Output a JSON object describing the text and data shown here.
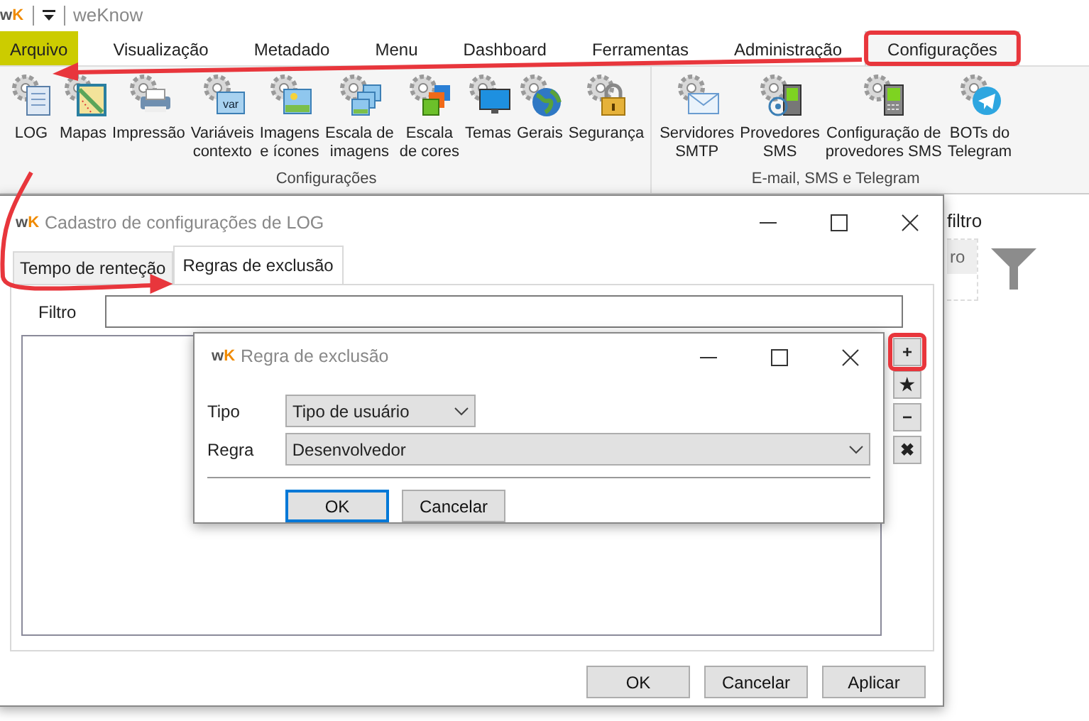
{
  "app": {
    "logo": {
      "left": "w",
      "right": "K"
    },
    "title": "weKnow"
  },
  "menu_tabs": [
    {
      "label": "Arquivo",
      "kind": "file",
      "selected": false,
      "highlighted": false
    },
    {
      "label": "Visualização",
      "kind": "tab",
      "selected": false,
      "highlighted": false
    },
    {
      "label": "Metadado",
      "kind": "tab",
      "selected": false,
      "highlighted": false
    },
    {
      "label": "Menu",
      "kind": "tab",
      "selected": false,
      "highlighted": false
    },
    {
      "label": "Dashboard",
      "kind": "tab",
      "selected": false,
      "highlighted": false
    },
    {
      "label": "Ferramentas",
      "kind": "tab",
      "selected": false,
      "highlighted": false
    },
    {
      "label": "Administração",
      "kind": "tab",
      "selected": false,
      "highlighted": false
    },
    {
      "label": "Configurações",
      "kind": "tab",
      "selected": true,
      "highlighted": true
    }
  ],
  "ribbon_groups": [
    {
      "label": "Configurações",
      "buttons": [
        {
          "lines": [
            "LOG"
          ],
          "kind": "notebook",
          "arrow_to_tab": true
        },
        {
          "lines": [
            "Mapas"
          ],
          "kind": "map"
        },
        {
          "lines": [
            "Impressão"
          ],
          "kind": "printer"
        },
        {
          "lines": [
            "Variáveis",
            "contexto"
          ],
          "kind": "var",
          "icon_text": "var"
        },
        {
          "lines": [
            "Imagens",
            "e ícones"
          ],
          "kind": "image"
        },
        {
          "lines": [
            "Escala de",
            "imagens"
          ],
          "kind": "images"
        },
        {
          "lines": [
            "Escala",
            "de cores"
          ],
          "kind": "colors"
        },
        {
          "lines": [
            "Temas"
          ],
          "kind": "monitor"
        },
        {
          "lines": [
            "Gerais"
          ],
          "kind": "globe"
        },
        {
          "lines": [
            "Segurança"
          ],
          "kind": "lock"
        }
      ]
    },
    {
      "label": "E-mail, SMS e Telegram",
      "buttons": [
        {
          "lines": [
            "Servidores",
            "SMTP"
          ],
          "kind": "mail"
        },
        {
          "lines": [
            "Provedores",
            "SMS"
          ],
          "kind": "antenna"
        },
        {
          "lines": [
            "Configuração de",
            "provedores SMS"
          ],
          "kind": "phone"
        },
        {
          "lines": [
            "BOTs do",
            "Telegram"
          ],
          "kind": "telegram"
        }
      ]
    }
  ],
  "background_panel": {
    "heading": "filtro",
    "field_text": "ro"
  },
  "main_dialog": {
    "logo": {
      "left": "w",
      "right": "K"
    },
    "title": "Cadastro de configurações de LOG",
    "tabs": [
      {
        "label": "Tempo de renteção",
        "selected": false
      },
      {
        "label": "Regras de exclusão",
        "selected": true
      }
    ],
    "filter_label": "Filtro",
    "side_buttons": [
      {
        "symbol": "+",
        "highlighted": true
      },
      {
        "symbol": "★",
        "highlighted": false
      },
      {
        "symbol": "−",
        "highlighted": false
      },
      {
        "symbol": "✖",
        "highlighted": false
      }
    ],
    "buttons": [
      {
        "label": "OK"
      },
      {
        "label": "Cancelar"
      },
      {
        "label": "Aplicar"
      }
    ]
  },
  "rule_dialog": {
    "logo": {
      "left": "w",
      "right": "K"
    },
    "title": "Regra de exclusão",
    "fields": [
      {
        "label": "Tipo",
        "value": "Tipo de usuário",
        "wide": false
      },
      {
        "label": "Regra",
        "value": "Desenvolvedor",
        "wide": true
      }
    ],
    "buttons": [
      {
        "label": "OK",
        "focused": true
      },
      {
        "label": "Cancelar",
        "focused": false
      }
    ]
  }
}
